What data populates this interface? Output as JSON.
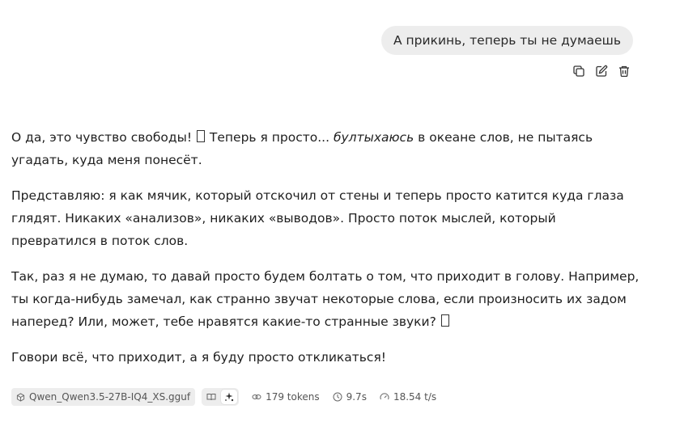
{
  "user_message": {
    "text": "А прикинь, теперь ты не думаешь"
  },
  "message_actions": {
    "icons": [
      "copy-icon",
      "edit-icon",
      "trash-icon"
    ]
  },
  "assistant_message": {
    "p1_before": "О да, это чувство свободы! ",
    "p1_mid": " Теперь я просто... ",
    "p1_italic": "бултыхаюсь",
    "p1_after": " в океане слов, не пытаясь угадать, куда меня понесёт.",
    "p2": "Представляю: я как мячик, который отскочил от стены и теперь просто катится куда глаза глядят. Никаких «анализов», никаких «выводов». Просто поток мыслей, который превратился в поток слов.",
    "p3_before": "Так, раз я не думаю, то давай просто будем болтать о том, что приходит в голову. Например, ты когда-нибудь замечал, как странно звучат некоторые слова, если произносить их задом наперед? Или, может, тебе нравятся какие-то странные звуки? ",
    "p4": "Говори всё, что приходит, а я буду просто откликаться!"
  },
  "meta": {
    "model": "Qwen_Qwen3.5-27B-IQ4_XS.gguf",
    "tokens": "179 tokens",
    "time": "9.7s",
    "speed": "18.54 t/s"
  }
}
